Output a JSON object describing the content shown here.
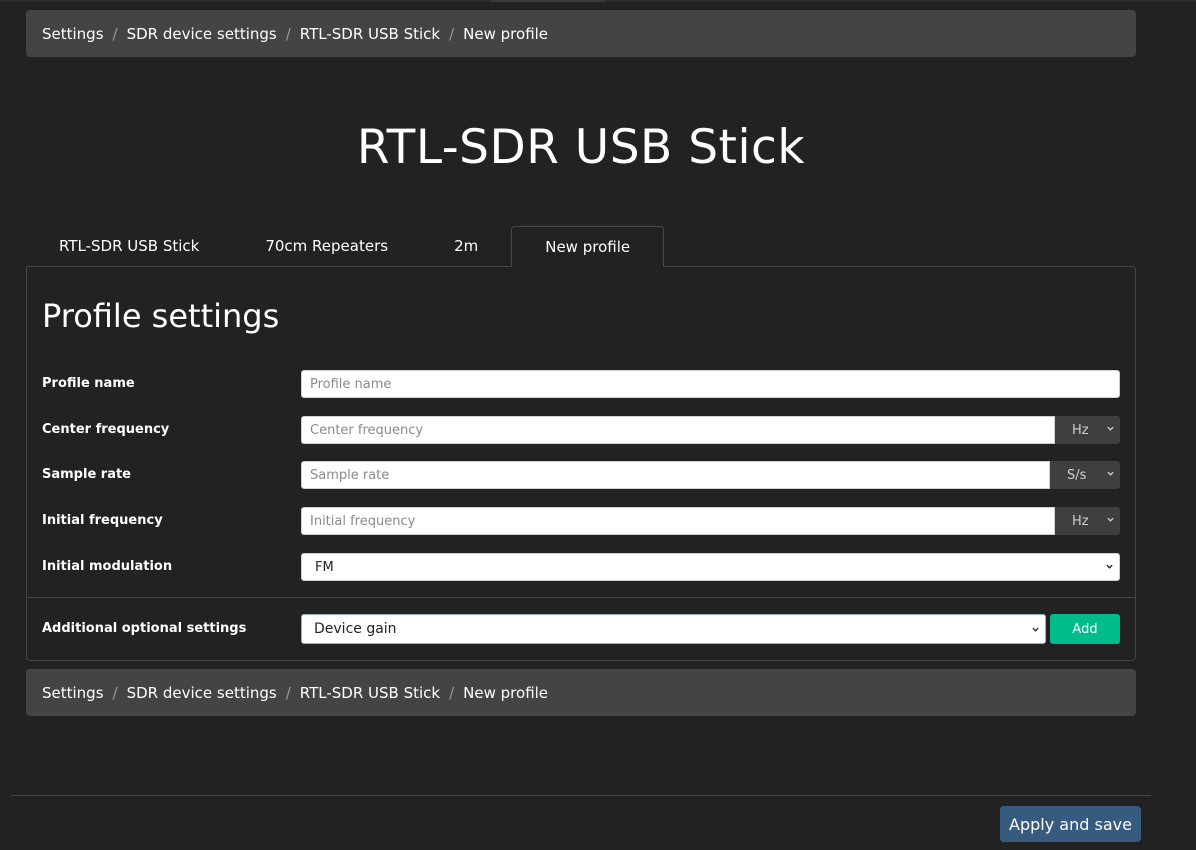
{
  "breadcrumb": {
    "items": [
      "Settings",
      "SDR device settings",
      "RTL-SDR USB Stick",
      "New profile"
    ],
    "separator": "/"
  },
  "page_title": "RTL-SDR USB Stick",
  "tabs": [
    {
      "label": "RTL-SDR USB Stick",
      "active": false
    },
    {
      "label": "70cm Repeaters",
      "active": false
    },
    {
      "label": "2m",
      "active": false
    },
    {
      "label": "New profile",
      "active": true
    }
  ],
  "profile": {
    "title": "Profile settings",
    "profile_name": {
      "label": "Profile name",
      "placeholder": "Profile name",
      "value": ""
    },
    "center_frequency": {
      "label": "Center frequency",
      "placeholder": "Center frequency",
      "value": "",
      "unit": "Hz"
    },
    "sample_rate": {
      "label": "Sample rate",
      "placeholder": "Sample rate",
      "value": "",
      "unit": "S/s"
    },
    "initial_frequency": {
      "label": "Initial frequency",
      "placeholder": "Initial frequency",
      "value": "",
      "unit": "Hz"
    },
    "initial_modulation": {
      "label": "Initial modulation",
      "value": "FM"
    },
    "additional": {
      "label": "Additional optional settings",
      "value": "Device gain",
      "add_label": "Add"
    }
  },
  "footer": {
    "apply_label": "Apply and save"
  },
  "colors": {
    "background": "#222222",
    "breadcrumb_bg": "#444444",
    "add_button": "#00bc8c",
    "apply_button": "#375a7f",
    "unit_select_bg": "#3f3f3f"
  },
  "icons": {
    "select_arrow": "chevron-down-icon"
  }
}
